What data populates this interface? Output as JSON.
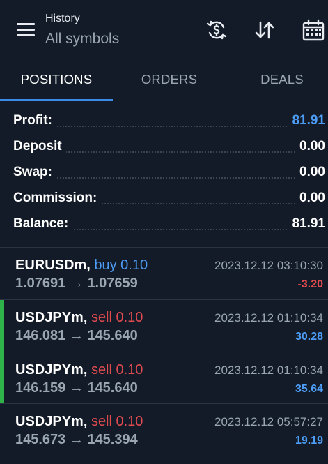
{
  "header": {
    "title": "History",
    "subtitle": "All symbols",
    "icons": [
      "currency-exchange-icon",
      "sort-arrows-icon",
      "calendar-icon"
    ]
  },
  "tabs": [
    {
      "label": "POSITIONS",
      "active": true
    },
    {
      "label": "ORDERS",
      "active": false
    },
    {
      "label": "DEALS",
      "active": false
    }
  ],
  "summary": [
    {
      "label": "Profit:",
      "value": "81.91",
      "color": "#4d9cf5"
    },
    {
      "label": "Deposit",
      "value": "0.00",
      "color": "#ffffff"
    },
    {
      "label": "Swap:",
      "value": "0.00",
      "color": "#ffffff"
    },
    {
      "label": "Commission:",
      "value": "0.00",
      "color": "#ffffff"
    },
    {
      "label": "Balance:",
      "value": "81.91",
      "color": "#ffffff"
    }
  ],
  "trades": [
    {
      "symbol": "EURUSDm,",
      "side": "buy 0.10",
      "side_color": "#4d9cf5",
      "open": "1.07691",
      "arrow": "→",
      "close": "1.07659",
      "time": "2023.12.12 03:10:30",
      "profit": "-3.20",
      "profit_color": "#e04b4f",
      "highlighted": false
    },
    {
      "symbol": "USDJPYm,",
      "side": "sell 0.10",
      "side_color": "#e04b4f",
      "open": "146.081",
      "arrow": "→",
      "close": "145.640",
      "time": "2023.12.12 01:10:34",
      "profit": "30.28",
      "profit_color": "#4d9cf5",
      "highlighted": true
    },
    {
      "symbol": "USDJPYm,",
      "side": "sell 0.10",
      "side_color": "#e04b4f",
      "open": "146.159",
      "arrow": "→",
      "close": "145.640",
      "time": "2023.12.12 01:10:34",
      "profit": "35.64",
      "profit_color": "#4d9cf5",
      "highlighted": true
    },
    {
      "symbol": "USDJPYm,",
      "side": "sell 0.10",
      "side_color": "#e04b4f",
      "open": "145.673",
      "arrow": "→",
      "close": "145.394",
      "time": "2023.12.12 05:57:27",
      "profit": "19.19",
      "profit_color": "#4d9cf5",
      "highlighted": false
    }
  ]
}
